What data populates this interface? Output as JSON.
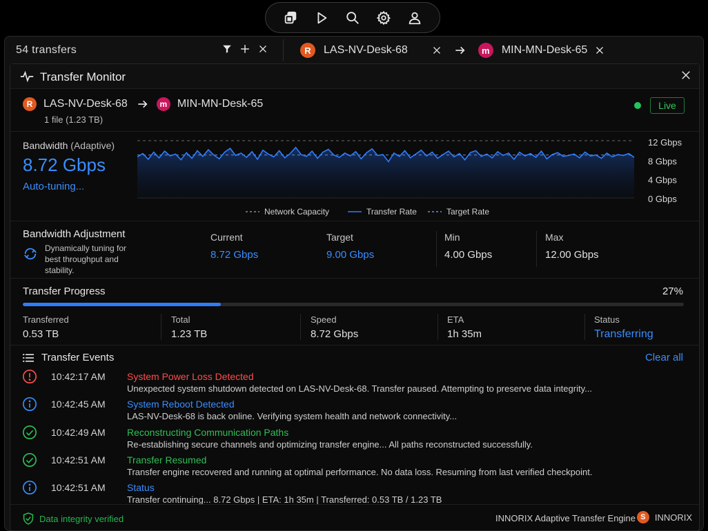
{
  "toolbar": {
    "icons": [
      "copy-icon",
      "play-icon",
      "search-icon",
      "gear-icon",
      "user-icon"
    ]
  },
  "transfer_bar": {
    "count": "54 transfers",
    "source": {
      "initial": "R",
      "name": "LAS-NV-Desk-68"
    },
    "dest": {
      "initial": "m",
      "name": "MIN-MN-Desk-65"
    }
  },
  "monitor": {
    "title": "Transfer Monitor",
    "source": {
      "initial": "R",
      "name": "LAS-NV-Desk-68"
    },
    "dest": {
      "initial": "m",
      "name": "MIN-MN-Desk-65"
    },
    "file_info": "1 file (1.23 TB)",
    "live": "Live"
  },
  "bandwidth": {
    "label": "Bandwidth",
    "mode": "(Adaptive)",
    "value": "8.72 Gbps",
    "status": "Auto-tuning..."
  },
  "chart_data": {
    "type": "line",
    "y_ticks": [
      "12 Gbps",
      "8 Gbps",
      "4 Gbps",
      "0 Gbps"
    ],
    "ylim": [
      0,
      12
    ],
    "legend": [
      "Network Capacity",
      "Transfer Rate",
      "Target Rate"
    ],
    "capacity": 12,
    "target": 9,
    "series": [
      {
        "name": "Transfer Rate",
        "values": [
          8.6,
          9.3,
          8.1,
          9.6,
          8.4,
          9.8,
          8.8,
          9.2,
          8.0,
          9.5,
          8.3,
          9.9,
          8.7,
          10.1,
          9.0,
          8.2,
          9.6,
          10.4,
          8.9,
          9.4,
          8.5,
          9.7,
          8.1,
          10.0,
          9.2,
          8.6,
          9.9,
          8.4,
          9.3,
          10.6,
          9.1,
          8.7,
          9.8,
          8.3,
          9.6,
          10.2,
          9.0,
          8.5,
          9.4,
          8.8,
          9.7,
          8.2,
          9.5,
          10.3,
          8.9,
          9.1,
          7.6,
          9.4,
          8.7,
          9.9,
          8.4,
          9.2,
          10.0,
          8.8,
          9.6,
          8.3,
          9.1,
          9.8,
          8.6,
          9.3,
          8.0,
          9.5,
          9.9,
          8.7,
          9.2,
          8.4,
          9.7,
          8.9,
          9.4,
          8.1,
          9.6,
          8.8,
          9.3,
          8.5,
          9.8,
          8.2,
          9.1,
          9.5,
          8.7,
          8.9,
          9.2,
          8.4,
          9.6,
          8.8,
          9.0,
          8.3,
          9.4,
          8.6,
          9.1,
          8.9,
          9.3,
          8.5
        ]
      }
    ]
  },
  "adjustment": {
    "title": "Bandwidth Adjustment",
    "desc": "Dynamically tuning for best throughput and stability.",
    "current_label": "Current",
    "current": "8.72 Gbps",
    "target_label": "Target",
    "target": "9.00 Gbps",
    "min_label": "Min",
    "min": "4.00 Gbps",
    "max_label": "Max",
    "max": "12.00 Gbps"
  },
  "progress": {
    "title": "Transfer Progress",
    "percent": "27%",
    "fraction": 0.3,
    "transferred_label": "Transferred",
    "transferred": "0.53 TB",
    "total_label": "Total",
    "total": "1.23 TB",
    "speed_label": "Speed",
    "speed": "8.72 Gbps",
    "eta_label": "ETA",
    "eta": "1h 35m",
    "status_label": "Status",
    "status": "Transferring"
  },
  "events": {
    "title": "Transfer Events",
    "clear": "Clear all",
    "items": [
      {
        "icon": "error-icon",
        "time": "10:42:17 AM",
        "name": "System Power Loss Detected",
        "color": "#ff4d4d",
        "desc": "Unexpected system shutdown detected on LAS-NV-Desk-68. Transfer paused. Attempting to preserve data integrity..."
      },
      {
        "icon": "info-icon",
        "time": "10:42:45 AM",
        "name": "System Reboot Detected",
        "color": "#3a8dff",
        "desc": "LAS-NV-Desk-68 is back online. Verifying system health and network connectivity..."
      },
      {
        "icon": "check-icon",
        "time": "10:42:49 AM",
        "name": "Reconstructing Communication Paths",
        "color": "#2fbf56",
        "desc": "Re-establishing secure channels and optimizing transfer engine... All paths reconstructed successfully."
      },
      {
        "icon": "check-icon",
        "time": "10:42:51 AM",
        "name": "Transfer Resumed",
        "color": "#2fbf56",
        "desc": "Transfer engine recovered and running at optimal performance. No data loss. Resuming from last verified checkpoint."
      },
      {
        "icon": "info-icon",
        "time": "10:42:51 AM",
        "name": "Status",
        "color": "#3a8dff",
        "desc": "Transfer continuing... 8.72 Gbps | ETA: 1h 35m | Transferred: 0.53 TB / 1.23 TB"
      }
    ]
  },
  "footer": {
    "integrity": "Data integrity verified",
    "engine": "INNORIX Adaptive Transfer Engine",
    "brand_initial": "S",
    "brand": "INNORIX"
  }
}
